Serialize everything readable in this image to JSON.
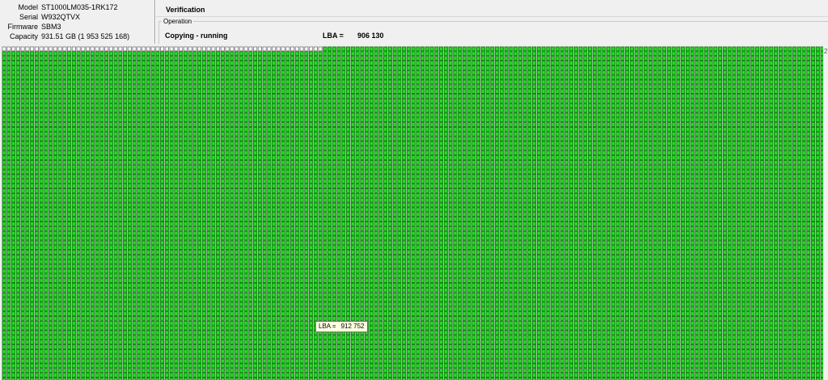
{
  "device": {
    "model_label": "Model",
    "model": "ST1000LM035-1RK172",
    "serial_label": "Serial",
    "serial": "W932QTVX",
    "firmware_label": "Firmware",
    "firmware": "SBM3",
    "capacity_label": "Capacity",
    "capacity": "931.51 GB (1 953 525 168)"
  },
  "panel": {
    "title": "Verification",
    "group_label": "Operation",
    "status": "Copying - running",
    "lba_label": "LBA =",
    "lba_value": "906 130"
  },
  "block_map": {
    "columns": 177,
    "rows": 71,
    "unprocessed_in_first_row": 69,
    "colors": {
      "read_ok_fill": "#22dd22",
      "read_ok_border": "#137a13",
      "unread_fill": "#ffffff",
      "unread_border": "#808080",
      "background": "#f0f0f0"
    },
    "scroll_marker": "2"
  },
  "tooltip": {
    "label": "LBA =",
    "value": "912 752"
  }
}
